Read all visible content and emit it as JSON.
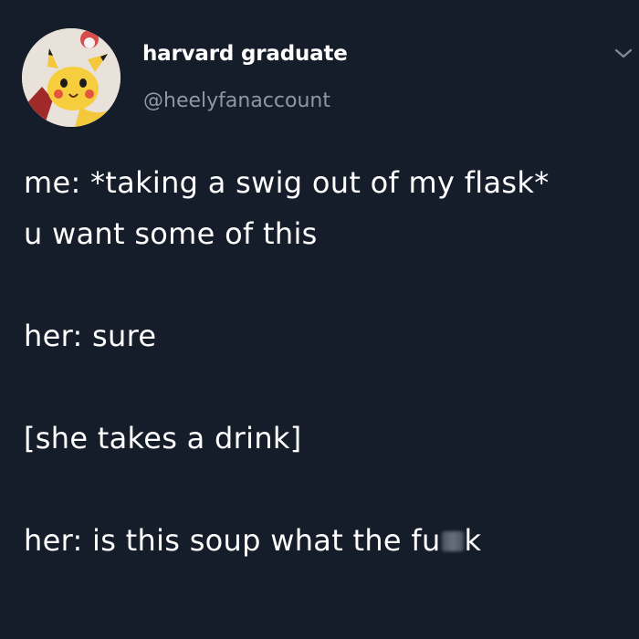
{
  "author": {
    "display_name": "harvard graduate",
    "handle": "@heelyfanaccount",
    "avatar_icon": "pikachu-avatar-icon"
  },
  "menu": {
    "icon": "chevron-down-icon"
  },
  "tweet": {
    "lines": [
      "me: *taking a swig out of my flask*",
      "u want some of this",
      "her: sure",
      "[she takes a drink]"
    ],
    "last_line_start": "her: is this soup what the fu",
    "last_line_end": "k"
  },
  "colors": {
    "background": "#151c2a",
    "text": "#ffffff",
    "handle": "#8f97a6"
  }
}
